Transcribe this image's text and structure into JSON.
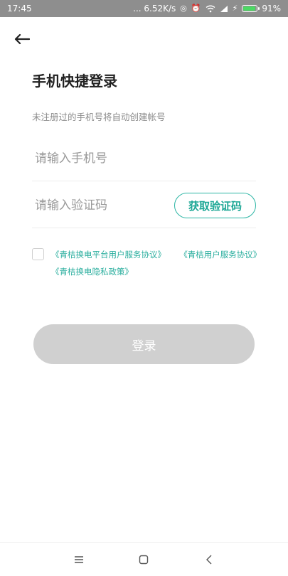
{
  "status_bar": {
    "time": "17:45",
    "network_speed": "... 6.52K/s",
    "battery_percent": "91%",
    "battery_level": 0.91,
    "icons": [
      "signal-icon",
      "alarm-icon",
      "wifi-icon",
      "cell-signal-icon",
      "charging-icon",
      "battery-icon"
    ]
  },
  "header": {
    "back_icon": "arrow-left-icon",
    "title": "手机快捷登录",
    "subtitle": "未注册过的手机号将自动创建帐号"
  },
  "form": {
    "phone_placeholder": "请输入手机号",
    "phone_value": "",
    "code_placeholder": "请输入验证码",
    "code_value": "",
    "get_code_label": "获取验证码"
  },
  "agreements": {
    "checked": false,
    "platform_agreement": "《青桔换电平台用户服务协议》",
    "user_agreement": "《青桔用户服务协议》",
    "privacy_policy": "《青桔换电隐私政策》"
  },
  "login_button": {
    "label": "登录"
  },
  "nav_bar": {
    "icons": [
      "menu-icon",
      "home-icon",
      "back-icon"
    ]
  },
  "colors": {
    "accent": "#2bb5a4",
    "status_bar": "#8e8e8e",
    "disabled_button": "#d0d0d0"
  }
}
